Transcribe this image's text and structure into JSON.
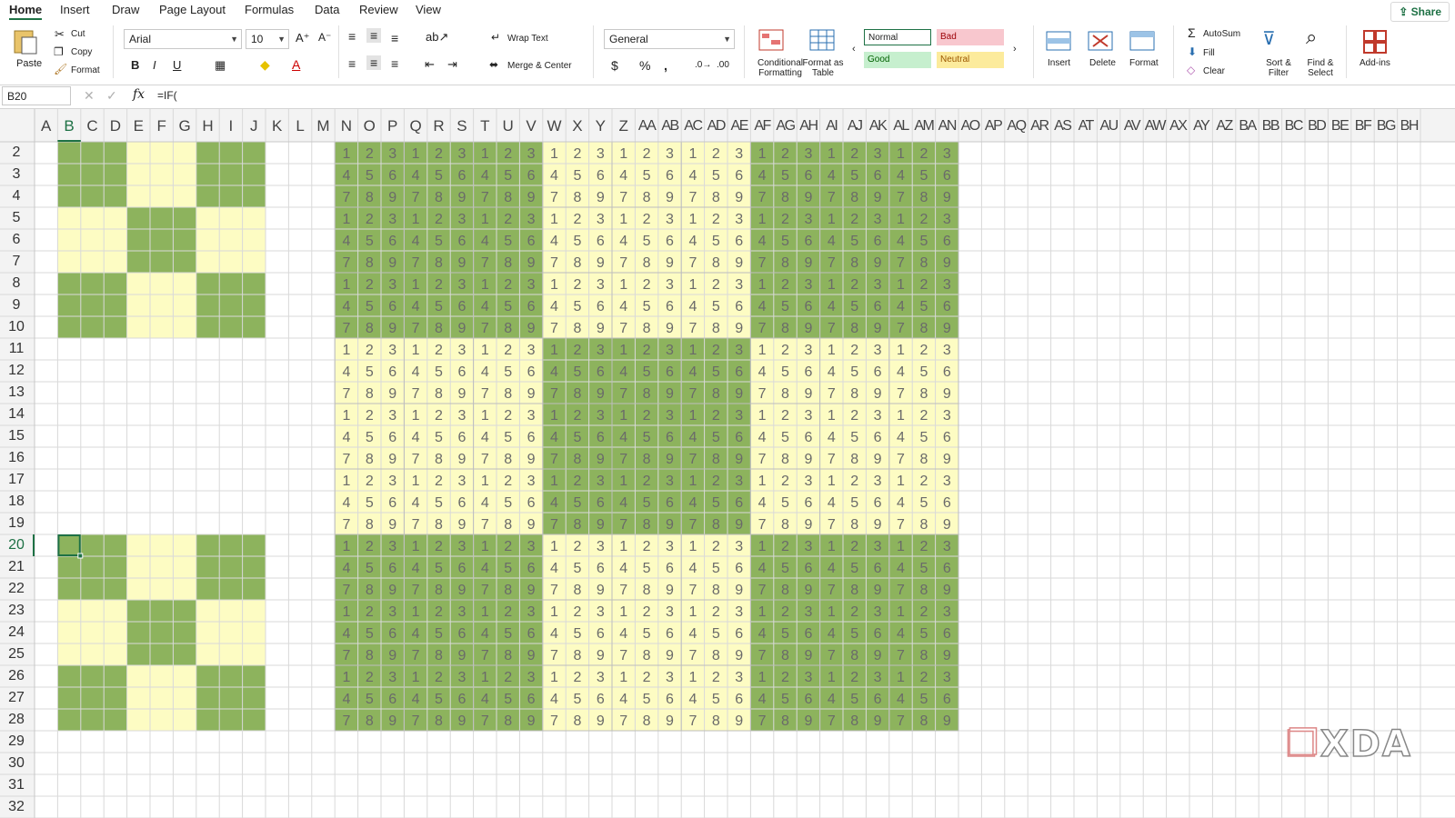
{
  "tabs": [
    "Home",
    "Insert",
    "Draw",
    "Page Layout",
    "Formulas",
    "Data",
    "Review",
    "View"
  ],
  "share_label": "Share",
  "clipboard": {
    "paste": "Paste",
    "cut": "Cut",
    "copy": "Copy",
    "format": "Format"
  },
  "font": {
    "name": "Arial",
    "size": "10"
  },
  "alignment": {
    "wrap_text": "Wrap Text",
    "merge_center": "Merge & Center"
  },
  "number": {
    "format": "General"
  },
  "styles_group": {
    "conditional_formatting": "Conditional Formatting",
    "format_as_table": "Format as Table",
    "normal": "Normal",
    "bad": "Bad",
    "good": "Good",
    "neutral": "Neutral"
  },
  "cells_group": {
    "insert": "Insert",
    "delete": "Delete",
    "format": "Format"
  },
  "editing": {
    "autosum": "AutoSum",
    "fill": "Fill",
    "clear": "Clear",
    "sort_filter": "Sort & Filter",
    "find_select": "Find & Select"
  },
  "addins": "Add-ins",
  "name_box": "B20",
  "formula": "=IF(",
  "columns": [
    "A",
    "B",
    "C",
    "D",
    "E",
    "F",
    "G",
    "H",
    "I",
    "J",
    "K",
    "L",
    "M",
    "N",
    "O",
    "P",
    "Q",
    "R",
    "S",
    "T",
    "U",
    "V",
    "W",
    "X",
    "Y",
    "Z",
    "AA",
    "AB",
    "AC",
    "AD",
    "AE",
    "AF",
    "AG",
    "AH",
    "AI",
    "AJ",
    "AK",
    "AL",
    "AM",
    "AN",
    "AO",
    "AP",
    "AQ",
    "AR",
    "AS",
    "AT",
    "AU",
    "AV",
    "AW",
    "AX",
    "AY",
    "AZ",
    "BA",
    "BB",
    "BC",
    "BD",
    "BE",
    "BF",
    "BG",
    "BH"
  ],
  "rows": [
    "2",
    "3",
    "4",
    "5",
    "6",
    "7",
    "8",
    "9",
    "10",
    "11",
    "12",
    "13",
    "14",
    "15",
    "16",
    "17",
    "18",
    "19",
    "20",
    "21",
    "22",
    "23",
    "24",
    "25",
    "26",
    "27",
    "28",
    "29",
    "30",
    "31",
    "32"
  ],
  "selected_col": "B",
  "selected_row": "20",
  "sudoku_digits": [
    [
      "1",
      "2",
      "3"
    ],
    [
      "4",
      "5",
      "6"
    ],
    [
      "7",
      "8",
      "9"
    ]
  ],
  "colors": {
    "green": "#8db35d",
    "yellow": "#fdfcc3",
    "accent": "#1e7145",
    "bad": "#f8c7ce",
    "good": "#c6efce",
    "neutral": "#fceb9c"
  },
  "watermark": "XDA"
}
